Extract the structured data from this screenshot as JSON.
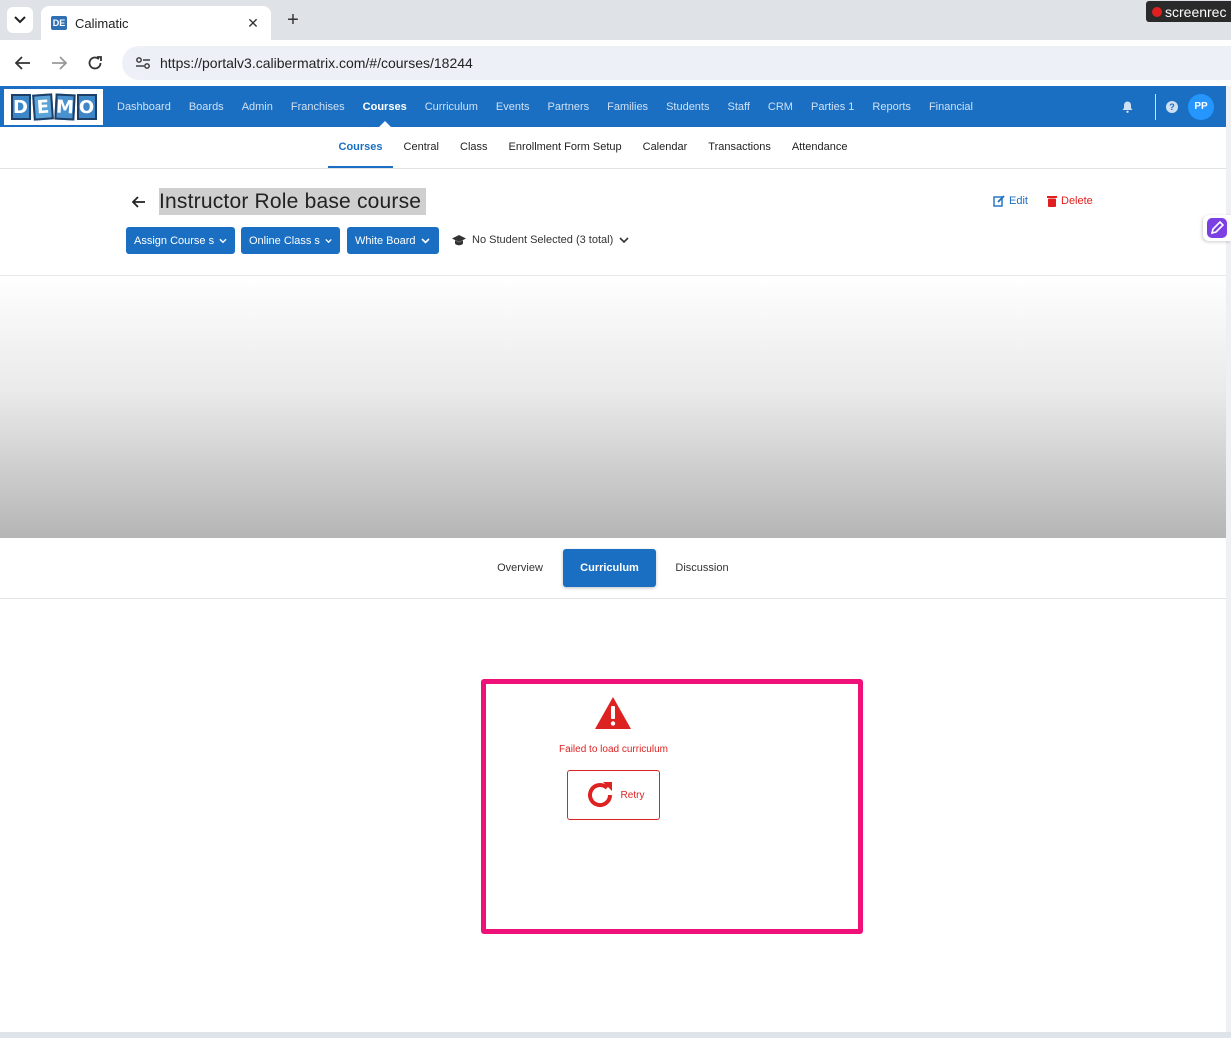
{
  "browser": {
    "tab_title": "Calimatic",
    "favicon_text": "DE",
    "url": "https://portalv3.calibermatrix.com/#/courses/18244",
    "recorder_label": "screenrec"
  },
  "logo": {
    "letters": [
      "D",
      "E",
      "M",
      "O"
    ]
  },
  "nav": {
    "items": [
      "Dashboard",
      "Boards",
      "Admin",
      "Franchises",
      "Courses",
      "Curriculum",
      "Events",
      "Partners",
      "Families",
      "Students",
      "Staff",
      "CRM",
      "Parties 1",
      "Reports",
      "Financial"
    ],
    "active": "Courses",
    "help_glyph": "?",
    "avatar_initials": "PP"
  },
  "subnav": {
    "items": [
      "Courses",
      "Central",
      "Class",
      "Enrollment Form Setup",
      "Calendar",
      "Transactions",
      "Attendance"
    ],
    "active": "Courses"
  },
  "course": {
    "title": "Instructor Role base course",
    "edit_label": "Edit",
    "delete_label": "Delete",
    "buttons": [
      "Assign Course s",
      "Online Class s",
      "White Board"
    ],
    "student_select": "No Student Selected (3 total)"
  },
  "content_tabs": {
    "items": [
      "Overview",
      "Curriculum",
      "Discussion"
    ],
    "active": "Curriculum"
  },
  "error": {
    "message": "Failed to load curriculum",
    "retry_label": "Retry"
  },
  "colors": {
    "primary": "#1a6fc2",
    "danger": "#dd2222",
    "highlight_frame": "#f0107a"
  }
}
